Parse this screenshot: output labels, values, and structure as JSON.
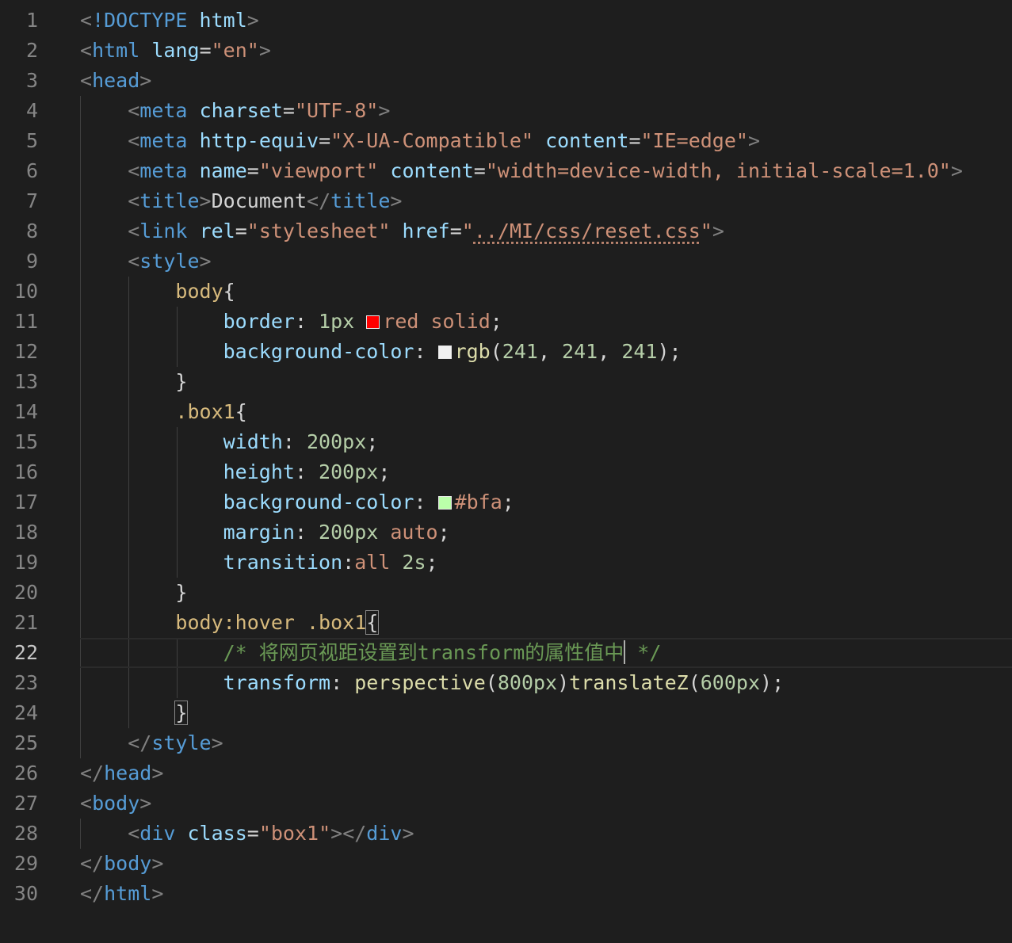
{
  "editor": {
    "theme_colors": {
      "background": "#1e1e1e",
      "line_number": "#858585",
      "active_line_number": "#c6c6c6",
      "punctuation_tag": "#808080",
      "tag": "#569cd6",
      "attribute": "#9cdcfe",
      "string": "#ce9178",
      "text": "#d4d4d4",
      "selector": "#d7ba7d",
      "number": "#b5cea8",
      "function": "#dcdcaa",
      "comment": "#6a9955"
    },
    "active_line": 22,
    "lines": [
      {
        "n": "1",
        "guides": 0,
        "tokens": [
          [
            "pt",
            "<"
          ],
          [
            "tg",
            "!DOCTYPE"
          ],
          [
            "tx",
            " "
          ],
          [
            "at",
            "html"
          ],
          [
            "pt",
            ">"
          ]
        ]
      },
      {
        "n": "2",
        "guides": 0,
        "tokens": [
          [
            "pt",
            "<"
          ],
          [
            "tg",
            "html"
          ],
          [
            "tx",
            " "
          ],
          [
            "at",
            "lang"
          ],
          [
            "tx",
            "="
          ],
          [
            "st",
            "\"en\""
          ],
          [
            "pt",
            ">"
          ]
        ]
      },
      {
        "n": "3",
        "guides": 0,
        "tokens": [
          [
            "pt",
            "<"
          ],
          [
            "tg",
            "head"
          ],
          [
            "pt",
            ">"
          ]
        ]
      },
      {
        "n": "4",
        "guides": 1,
        "tokens": [
          [
            "tx",
            "    "
          ],
          [
            "pt",
            "<"
          ],
          [
            "tg",
            "meta"
          ],
          [
            "tx",
            " "
          ],
          [
            "at",
            "charset"
          ],
          [
            "tx",
            "="
          ],
          [
            "st",
            "\"UTF-8\""
          ],
          [
            "pt",
            ">"
          ]
        ]
      },
      {
        "n": "5",
        "guides": 1,
        "tokens": [
          [
            "tx",
            "    "
          ],
          [
            "pt",
            "<"
          ],
          [
            "tg",
            "meta"
          ],
          [
            "tx",
            " "
          ],
          [
            "at",
            "http-equiv"
          ],
          [
            "tx",
            "="
          ],
          [
            "st",
            "\"X-UA-Compatible\""
          ],
          [
            "tx",
            " "
          ],
          [
            "at",
            "content"
          ],
          [
            "tx",
            "="
          ],
          [
            "st",
            "\"IE=edge\""
          ],
          [
            "pt",
            ">"
          ]
        ]
      },
      {
        "n": "6",
        "guides": 1,
        "tokens": [
          [
            "tx",
            "    "
          ],
          [
            "pt",
            "<"
          ],
          [
            "tg",
            "meta"
          ],
          [
            "tx",
            " "
          ],
          [
            "at",
            "name"
          ],
          [
            "tx",
            "="
          ],
          [
            "st",
            "\"viewport\""
          ],
          [
            "tx",
            " "
          ],
          [
            "at",
            "content"
          ],
          [
            "tx",
            "="
          ],
          [
            "st",
            "\"width=device-width, initial-scale=1.0\""
          ],
          [
            "pt",
            ">"
          ]
        ]
      },
      {
        "n": "7",
        "guides": 1,
        "tokens": [
          [
            "tx",
            "    "
          ],
          [
            "pt",
            "<"
          ],
          [
            "tg",
            "title"
          ],
          [
            "pt",
            ">"
          ],
          [
            "tx",
            "Document"
          ],
          [
            "pt",
            "</"
          ],
          [
            "tg",
            "title"
          ],
          [
            "pt",
            ">"
          ]
        ]
      },
      {
        "n": "8",
        "guides": 1,
        "tokens": [
          [
            "tx",
            "    "
          ],
          [
            "pt",
            "<"
          ],
          [
            "tg",
            "link"
          ],
          [
            "tx",
            " "
          ],
          [
            "at",
            "rel"
          ],
          [
            "tx",
            "="
          ],
          [
            "st",
            "\"stylesheet\""
          ],
          [
            "tx",
            " "
          ],
          [
            "at",
            "href"
          ],
          [
            "tx",
            "="
          ],
          [
            "st",
            "\""
          ],
          [
            "stu",
            "../MI/css/reset.css"
          ],
          [
            "st",
            "\""
          ],
          [
            "pt",
            ">"
          ]
        ]
      },
      {
        "n": "9",
        "guides": 1,
        "tokens": [
          [
            "tx",
            "    "
          ],
          [
            "pt",
            "<"
          ],
          [
            "tg",
            "style"
          ],
          [
            "pt",
            ">"
          ]
        ]
      },
      {
        "n": "10",
        "guides": 2,
        "tokens": [
          [
            "tx",
            "        "
          ],
          [
            "sel",
            "body"
          ],
          [
            "tx",
            "{"
          ]
        ]
      },
      {
        "n": "11",
        "guides": 3,
        "tokens": [
          [
            "tx",
            "            "
          ],
          [
            "at",
            "border"
          ],
          [
            "tx",
            ": "
          ],
          [
            "nm",
            "1px"
          ],
          [
            "tx",
            " "
          ],
          [
            "sw",
            "#ff0000"
          ],
          [
            "st",
            "red"
          ],
          [
            "tx",
            " "
          ],
          [
            "st",
            "solid"
          ],
          [
            "tx",
            ";"
          ]
        ]
      },
      {
        "n": "12",
        "guides": 3,
        "tokens": [
          [
            "tx",
            "            "
          ],
          [
            "at",
            "background-color"
          ],
          [
            "tx",
            ": "
          ],
          [
            "sw",
            "#f1f1f1"
          ],
          [
            "fn",
            "rgb"
          ],
          [
            "tx",
            "("
          ],
          [
            "nm",
            "241"
          ],
          [
            "tx",
            ", "
          ],
          [
            "nm",
            "241"
          ],
          [
            "tx",
            ", "
          ],
          [
            "nm",
            "241"
          ],
          [
            "tx",
            ");"
          ]
        ]
      },
      {
        "n": "13",
        "guides": 2,
        "tokens": [
          [
            "tx",
            "        }"
          ]
        ]
      },
      {
        "n": "14",
        "guides": 2,
        "tokens": [
          [
            "tx",
            "        "
          ],
          [
            "sel",
            ".box1"
          ],
          [
            "tx",
            "{"
          ]
        ]
      },
      {
        "n": "15",
        "guides": 3,
        "tokens": [
          [
            "tx",
            "            "
          ],
          [
            "at",
            "width"
          ],
          [
            "tx",
            ": "
          ],
          [
            "nm",
            "200px"
          ],
          [
            "tx",
            ";"
          ]
        ]
      },
      {
        "n": "16",
        "guides": 3,
        "tokens": [
          [
            "tx",
            "            "
          ],
          [
            "at",
            "height"
          ],
          [
            "tx",
            ": "
          ],
          [
            "nm",
            "200px"
          ],
          [
            "tx",
            ";"
          ]
        ]
      },
      {
        "n": "17",
        "guides": 3,
        "tokens": [
          [
            "tx",
            "            "
          ],
          [
            "at",
            "background-color"
          ],
          [
            "tx",
            ": "
          ],
          [
            "sw",
            "#bbffaa"
          ],
          [
            "st",
            "#bfa"
          ],
          [
            "tx",
            ";"
          ]
        ]
      },
      {
        "n": "18",
        "guides": 3,
        "tokens": [
          [
            "tx",
            "            "
          ],
          [
            "at",
            "margin"
          ],
          [
            "tx",
            ": "
          ],
          [
            "nm",
            "200px"
          ],
          [
            "tx",
            " "
          ],
          [
            "st",
            "auto"
          ],
          [
            "tx",
            ";"
          ]
        ]
      },
      {
        "n": "19",
        "guides": 3,
        "tokens": [
          [
            "tx",
            "            "
          ],
          [
            "at",
            "transition"
          ],
          [
            "tx",
            ":"
          ],
          [
            "st",
            "all"
          ],
          [
            "tx",
            " "
          ],
          [
            "nm",
            "2s"
          ],
          [
            "tx",
            ";"
          ]
        ]
      },
      {
        "n": "20",
        "guides": 2,
        "tokens": [
          [
            "tx",
            "        }"
          ]
        ]
      },
      {
        "n": "21",
        "guides": 2,
        "tokens": [
          [
            "tx",
            "        "
          ],
          [
            "sel",
            "body:hover .box1"
          ],
          [
            "bx",
            "{"
          ]
        ]
      },
      {
        "n": "22",
        "guides": 3,
        "tokens": [
          [
            "tx",
            "            "
          ],
          [
            "cm",
            "/* 将网页视距设置到transform的属性值中"
          ],
          [
            "caret",
            ""
          ],
          [
            "cm",
            " */"
          ]
        ]
      },
      {
        "n": "23",
        "guides": 3,
        "tokens": [
          [
            "tx",
            "            "
          ],
          [
            "at",
            "transform"
          ],
          [
            "tx",
            ": "
          ],
          [
            "fn",
            "perspective"
          ],
          [
            "tx",
            "("
          ],
          [
            "nm",
            "800px"
          ],
          [
            "tx",
            ")"
          ],
          [
            "fn",
            "translateZ"
          ],
          [
            "tx",
            "("
          ],
          [
            "nm",
            "600px"
          ],
          [
            "tx",
            ");"
          ]
        ]
      },
      {
        "n": "24",
        "guides": 2,
        "tokens": [
          [
            "tx",
            "        "
          ],
          [
            "bx",
            "}"
          ]
        ]
      },
      {
        "n": "25",
        "guides": 1,
        "tokens": [
          [
            "tx",
            "    "
          ],
          [
            "pt",
            "</"
          ],
          [
            "tg",
            "style"
          ],
          [
            "pt",
            ">"
          ]
        ]
      },
      {
        "n": "26",
        "guides": 0,
        "tokens": [
          [
            "pt",
            "</"
          ],
          [
            "tg",
            "head"
          ],
          [
            "pt",
            ">"
          ]
        ]
      },
      {
        "n": "27",
        "guides": 0,
        "tokens": [
          [
            "pt",
            "<"
          ],
          [
            "tg",
            "body"
          ],
          [
            "pt",
            ">"
          ]
        ]
      },
      {
        "n": "28",
        "guides": 1,
        "tokens": [
          [
            "tx",
            "    "
          ],
          [
            "pt",
            "<"
          ],
          [
            "tg",
            "div"
          ],
          [
            "tx",
            " "
          ],
          [
            "at",
            "class"
          ],
          [
            "tx",
            "="
          ],
          [
            "st",
            "\"box1\""
          ],
          [
            "pt",
            "></"
          ],
          [
            "tg",
            "div"
          ],
          [
            "pt",
            ">"
          ]
        ]
      },
      {
        "n": "29",
        "guides": 0,
        "tokens": [
          [
            "pt",
            "</"
          ],
          [
            "tg",
            "body"
          ],
          [
            "pt",
            ">"
          ]
        ]
      },
      {
        "n": "30",
        "guides": 0,
        "tokens": [
          [
            "pt",
            "</"
          ],
          [
            "tg",
            "html"
          ],
          [
            "pt",
            ">"
          ]
        ]
      }
    ]
  }
}
